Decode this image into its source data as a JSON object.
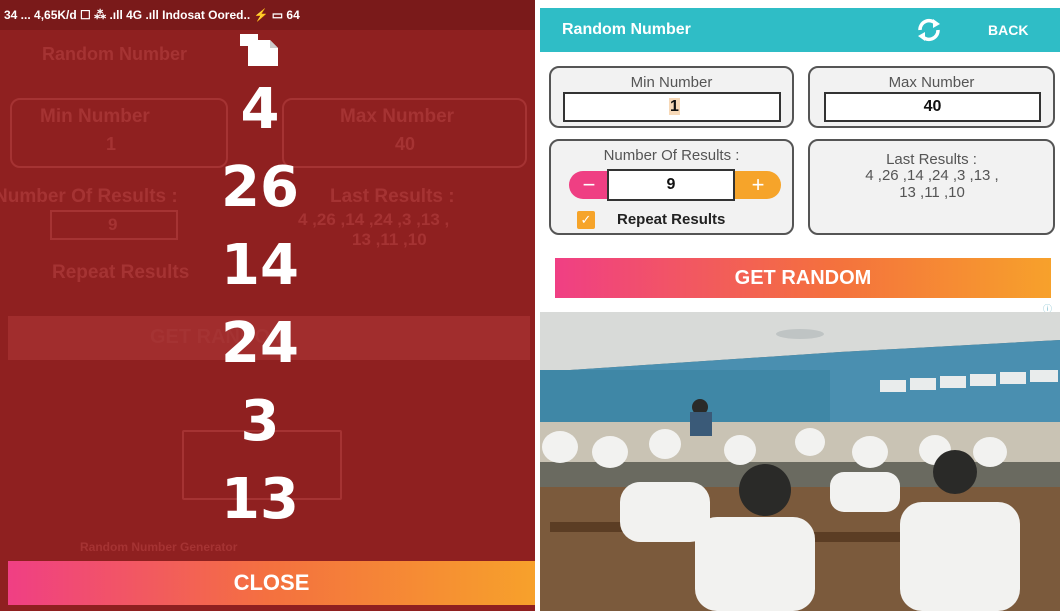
{
  "left": {
    "status_bar": {
      "text": "34 ... 4,65K/d ☐ ⁂ .ıll 4G .ıll Indosat Oored.. ⚡ ▭ 64"
    },
    "background_app": {
      "title": "Random Number",
      "min_label": "Min Number",
      "max_label": "Max Number",
      "min_value": "1",
      "max_value": "40",
      "count_label": "Number Of Results :",
      "count_value": "9",
      "last_results_label": "Last Results :",
      "last_results_line1": "4 ,26 ,14 ,24 ,3 ,13 ,",
      "last_results_line2": "13 ,11 ,10",
      "repeat_label": "Repeat Results",
      "button_label": "GET RANDOM",
      "footer": "Random Number Generator"
    },
    "results": [
      "4",
      "26",
      "14",
      "24",
      "3",
      "13"
    ],
    "close_label": "CLOSE"
  },
  "right": {
    "app_title": "Random Number",
    "back_label": "BACK",
    "min_label": "Min Number",
    "min_value": "1",
    "max_label": "Max Number",
    "max_value": "40",
    "count_label": "Number Of Results :",
    "count_value": "9",
    "stepper_minus": "−",
    "stepper_plus": "+",
    "repeat_checked_mark": "✓",
    "repeat_label": "Repeat Results",
    "last_results_label": "Last Results :",
    "last_results_line1": "4 ,26 ,14 ,24 ,3 ,13 ,",
    "last_results_line2": "13 ,11 ,10",
    "button_label": "GET RANDOM",
    "ad_choices_mark": "ⓘ"
  },
  "colors": {
    "overlay_red": "#8f2020",
    "appbar_teal": "#2fbdc6",
    "accent_pink": "#f03f84",
    "accent_orange": "#f7a12b"
  },
  "icons": {
    "copy": "copy-icon",
    "refresh": "refresh-icon",
    "checkbox": "checkbox-checked-icon"
  }
}
